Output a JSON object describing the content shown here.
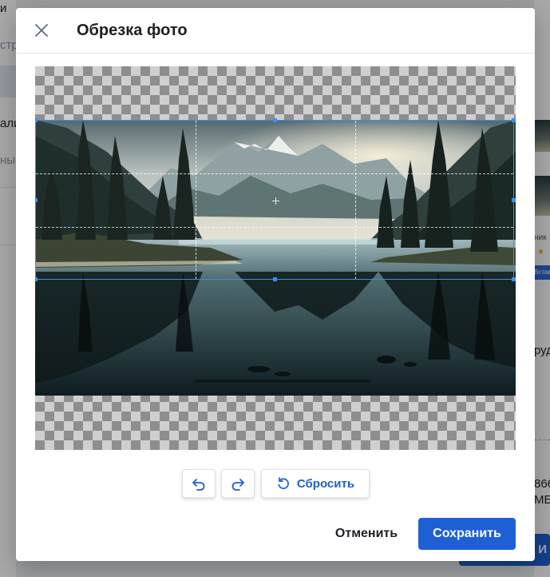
{
  "background": {
    "left_fragments": [
      "и",
      "стро",
      "али",
      "ные"
    ],
    "right_fragments": [
      "ник",
      "рудо",
      "866",
      "МБ",
      "ь И"
    ],
    "right_tag": "Вставк"
  },
  "modal": {
    "title": "Обрезка фото",
    "close_icon": "close-icon"
  },
  "crop": {
    "image_alt": "Горное озеро с отражением",
    "grid": "rule-of-thirds"
  },
  "toolbar": {
    "undo_icon": "undo-icon",
    "redo_icon": "redo-icon",
    "reset_icon": "rotate-ccw-icon",
    "reset_label": "Сбросить"
  },
  "footer": {
    "cancel_label": "Отменить",
    "save_label": "Сохранить"
  },
  "colors": {
    "accent": "#1f5fd6",
    "crop_border": "#3d8cf0",
    "overlay": "rgba(0,0,0,0.34)"
  }
}
